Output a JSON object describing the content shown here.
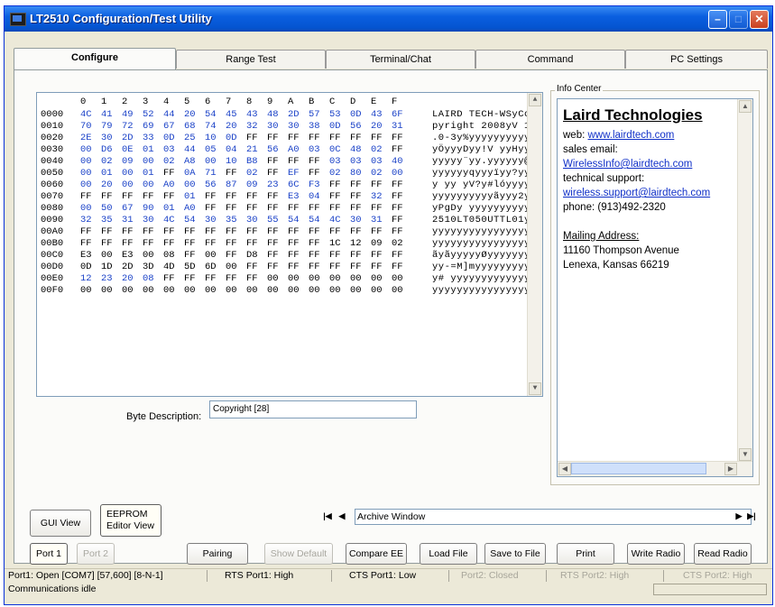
{
  "window": {
    "title": "LT2510 Configuration/Test Utility"
  },
  "tabs": [
    "Configure",
    "Range Test",
    "Terminal/Chat",
    "Command",
    "PC Settings"
  ],
  "hex": {
    "header": [
      "0",
      "1",
      "2",
      "3",
      "4",
      "5",
      "6",
      "7",
      "8",
      "9",
      "A",
      "B",
      "C",
      "D",
      "E",
      "F"
    ],
    "rows": [
      {
        "addr": "0000",
        "bytes": [
          "4C",
          "41",
          "49",
          "52",
          "44",
          "20",
          "54",
          "45",
          "43",
          "48",
          "2D",
          "57",
          "53",
          "0D",
          "43",
          "6F"
        ],
        "ascii": "LAIRD TECH-WSyCo"
      },
      {
        "addr": "0010",
        "bytes": [
          "70",
          "79",
          "72",
          "69",
          "67",
          "68",
          "74",
          "20",
          "32",
          "30",
          "30",
          "38",
          "0D",
          "56",
          "20",
          "31"
        ],
        "ascii": "pyright 2008yV 1"
      },
      {
        "addr": "0020",
        "bytes": [
          "2E",
          "30",
          "2D",
          "33",
          "0D",
          "25",
          "10",
          "0D",
          "FF",
          "FF",
          "FF",
          "FF",
          "FF",
          "FF",
          "FF",
          "FF"
        ],
        "ascii": ".0-3y%yyyyyyyyyy"
      },
      {
        "addr": "0030",
        "bytes": [
          "00",
          "D6",
          "0E",
          "01",
          "03",
          "44",
          "05",
          "04",
          "21",
          "56",
          "A0",
          "03",
          "0C",
          "48",
          "02",
          "FF"
        ],
        "ascii": "yÖyyyDyy!V yyHyy"
      },
      {
        "addr": "0040",
        "bytes": [
          "00",
          "02",
          "09",
          "00",
          "02",
          "A8",
          "00",
          "10",
          "B8",
          "FF",
          "FF",
          "FF",
          "03",
          "03",
          "03",
          "40"
        ],
        "ascii": "yyyyy¨yy.yyyyyy@"
      },
      {
        "addr": "0050",
        "bytes": [
          "00",
          "01",
          "00",
          "01",
          "FF",
          "0A",
          "71",
          "FF",
          "02",
          "FF",
          "EF",
          "FF",
          "02",
          "80",
          "02",
          "00"
        ],
        "ascii": "yyyyyyqyyyïyy?yy"
      },
      {
        "addr": "0060",
        "bytes": [
          "00",
          "20",
          "00",
          "00",
          "A0",
          "00",
          "56",
          "87",
          "09",
          "23",
          "6C",
          "F3",
          "FF",
          "FF",
          "FF",
          "FF"
        ],
        "ascii": "y yy yV?y#lóyyyy"
      },
      {
        "addr": "0070",
        "bytes": [
          "FF",
          "FF",
          "FF",
          "FF",
          "FF",
          "01",
          "FF",
          "FF",
          "FF",
          "FF",
          "E3",
          "04",
          "FF",
          "FF",
          "32",
          "FF"
        ],
        "ascii": "yyyyyyyyyyãyyy2y"
      },
      {
        "addr": "0080",
        "bytes": [
          "00",
          "50",
          "67",
          "90",
          "01",
          "A0",
          "FF",
          "FF",
          "FF",
          "FF",
          "FF",
          "FF",
          "FF",
          "FF",
          "FF",
          "FF"
        ],
        "ascii": "yPgDy yyyyyyyyyy"
      },
      {
        "addr": "0090",
        "bytes": [
          "32",
          "35",
          "31",
          "30",
          "4C",
          "54",
          "30",
          "35",
          "30",
          "55",
          "54",
          "54",
          "4C",
          "30",
          "31",
          "FF"
        ],
        "ascii": "2510LT050UTTL01y"
      },
      {
        "addr": "00A0",
        "bytes": [
          "FF",
          "FF",
          "FF",
          "FF",
          "FF",
          "FF",
          "FF",
          "FF",
          "FF",
          "FF",
          "FF",
          "FF",
          "FF",
          "FF",
          "FF",
          "FF"
        ],
        "ascii": "yyyyyyyyyyyyyyyy"
      },
      {
        "addr": "00B0",
        "bytes": [
          "FF",
          "FF",
          "FF",
          "FF",
          "FF",
          "FF",
          "FF",
          "FF",
          "FF",
          "FF",
          "FF",
          "FF",
          "1C",
          "12",
          "09",
          "02"
        ],
        "ascii": "yyyyyyyyyyyyyyyy"
      },
      {
        "addr": "00C0",
        "bytes": [
          "E3",
          "00",
          "E3",
          "00",
          "08",
          "FF",
          "00",
          "FF",
          "D8",
          "FF",
          "FF",
          "FF",
          "FF",
          "FF",
          "FF",
          "FF"
        ],
        "ascii": "ãyãyyyyyØyyyyyyy"
      },
      {
        "addr": "00D0",
        "bytes": [
          "0D",
          "1D",
          "2D",
          "3D",
          "4D",
          "5D",
          "6D",
          "00",
          "FF",
          "FF",
          "FF",
          "FF",
          "FF",
          "FF",
          "FF",
          "FF"
        ],
        "ascii": "yy-=M]myyyyyyyyy"
      },
      {
        "addr": "00E0",
        "bytes": [
          "12",
          "23",
          "20",
          "08",
          "FF",
          "FF",
          "FF",
          "FF",
          "FF",
          "00",
          "00",
          "00",
          "00",
          "00",
          "00",
          "00"
        ],
        "ascii": "y# yyyyyyyyyyyyy"
      },
      {
        "addr": "00F0",
        "bytes": [
          "00",
          "00",
          "00",
          "00",
          "00",
          "00",
          "00",
          "00",
          "00",
          "00",
          "00",
          "00",
          "00",
          "00",
          "00",
          "00"
        ],
        "ascii": "yyyyyyyyyyyyyyyy"
      }
    ]
  },
  "byte_description": {
    "label": "Byte Description:",
    "value": "Copyright [28]"
  },
  "info_center": {
    "legend": "Info Center",
    "company": "Laird Technologies",
    "web_label": "web:",
    "web_link": "www.lairdtech.com",
    "sales_label": "sales email:",
    "sales_link": "WirelessInfo@lairdtech.com",
    "support_label": "technical support:",
    "support_link": "wireless.support@lairdtech.com",
    "phone": "phone: (913)492-2320",
    "mailing_label": "Mailing Address:",
    "address1": "11160 Thompson Avenue",
    "address2": "Lenexa, Kansas 66219"
  },
  "view_buttons": {
    "gui": "GUI View",
    "eeprom_line1": "EEPROM",
    "eeprom_line2": "Editor View"
  },
  "archive": {
    "value": "Archive Window"
  },
  "port_buttons": {
    "port1": "Port 1",
    "port2": "Port 2"
  },
  "actions": {
    "pairing": "Pairing",
    "show_default": "Show Default",
    "compare_ee": "Compare EE",
    "load_file": "Load File",
    "save_file": "Save to File",
    "print": "Print",
    "write_radio": "Write Radio",
    "read_radio": "Read Radio"
  },
  "status": {
    "port1": "Port1: Open  [COM7] [57,600] [8-N-1]",
    "rts1": "RTS Port1: High",
    "cts1": "CTS Port1: Low",
    "port2": "Port2: Closed",
    "rts2": "RTS Port2: High",
    "cts2": "CTS Port2: High",
    "comm": "Communications idle"
  },
  "colors": {
    "title_bar": "#0a5fe0",
    "hex_blue": "#1c43c8",
    "link": "#1030c8"
  }
}
